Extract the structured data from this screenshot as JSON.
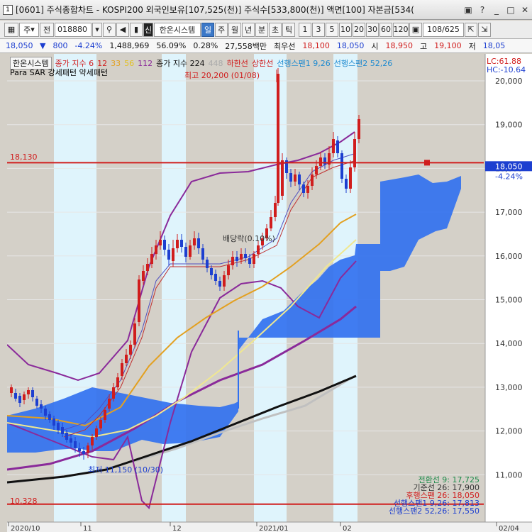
{
  "window": {
    "icon": "1",
    "title": "[0601] 주식종합차트 - KOSPI200 외국인보유[107,525(천)] 주식수[533,800(천)] 액면[100] 자본금[534("
  },
  "toolbar": {
    "market_select": "주",
    "prev_label": "전",
    "code": "018880",
    "system_label": "한온시스템",
    "period_tabs": [
      "일",
      "주",
      "월",
      "년",
      "분",
      "초",
      "틱"
    ],
    "active_period": "일",
    "intervals": [
      "1",
      "3",
      "5",
      "10",
      "20",
      "30",
      "60",
      "120"
    ],
    "page_count": "108/625"
  },
  "quote": {
    "price": "18,050",
    "change": "800",
    "change_pct": "-4.24%",
    "volume": "1,488,969",
    "volume_ratio": "56.09%",
    "turnover": "0.28%",
    "amount": "27,558백만",
    "best_ask_label": "최우선",
    "best_ask": "18,100",
    "best_bid": "18,050",
    "open_label": "시",
    "open": "18,950",
    "high_label": "고",
    "high": "19,100",
    "low_label": "저",
    "low": "18,05"
  },
  "legend": {
    "row1_items": [
      "한온시스템",
      "종가 지수 6",
      "12",
      "33",
      "56",
      "112",
      "종가 지수 224",
      "448",
      "하한선",
      "상한선",
      "선행스팬1 9,26",
      "선행스팬2 52,26"
    ],
    "row2": "Para SAR 강세패턴  약세패턴"
  },
  "annotations": {
    "high_marker": "최고 20,200 (01/08)",
    "low_marker": "최저 11,150 (10/30)",
    "dividend": "배당락(0.10%)",
    "line_18130": "18,130",
    "line_10328": "10,328",
    "lc": "LC:61.88",
    "hc": "HC:-10.64"
  },
  "right_axis": {
    "current_price": "18,050",
    "current_pct": "-4.24%",
    "ticks": [
      "20,000",
      "19,000",
      "18,000",
      "17,000",
      "16,000",
      "15,000",
      "14,000",
      "13,000",
      "12,000",
      "11,000"
    ]
  },
  "x_axis": {
    "labels": [
      "2020/10",
      "11",
      "12",
      "2021/01",
      "02",
      "02/04"
    ]
  },
  "indicator_summary": [
    "전환선 9: 17,725",
    "기준선 26: 17,900",
    "후행스팬 26: 18,050",
    "선행스팬1 9,26: 17,813",
    "선행스팬2 52,26: 17,550"
  ],
  "colors": {
    "rise": "#d01d1d",
    "fall": "#1d3fd0",
    "cloud": "#2f6ff0",
    "highlight": "#dff4fc",
    "ma5": "#e3a020",
    "ma_yellow": "#f0e890",
    "ma_purple": "#8a2a9a",
    "ma_black": "#111111",
    "ma_gray": "#c0c0c0"
  }
}
